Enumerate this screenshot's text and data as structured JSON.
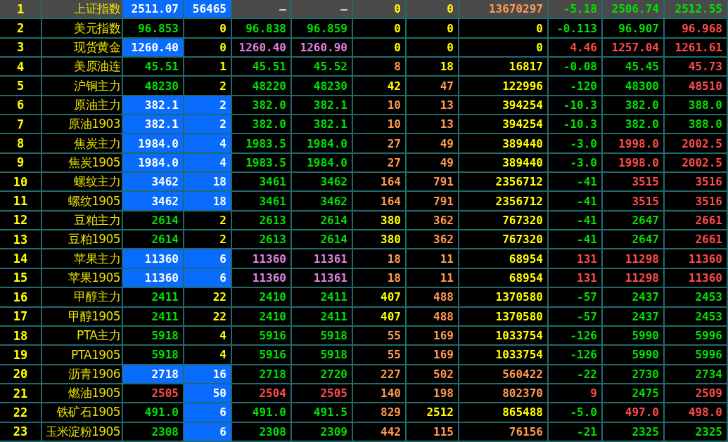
{
  "rows": [
    {
      "index": "1",
      "name": "上证指数",
      "selected": true,
      "cells": [
        {
          "text": "2511.07",
          "kind": "white",
          "highlighted": true
        },
        {
          "text": "56465",
          "kind": "white",
          "highlighted": true
        },
        {
          "text": "—",
          "kind": "none",
          "highlighted": false
        },
        {
          "text": "—",
          "kind": "none",
          "highlighted": false
        },
        {
          "text": "0",
          "kind": "neutral",
          "highlighted": false
        },
        {
          "text": "0",
          "kind": "neutral",
          "highlighted": false
        },
        {
          "text": "13670297",
          "kind": "active",
          "highlighted": false
        },
        {
          "text": "-5.18",
          "kind": "fall",
          "highlighted": false
        },
        {
          "text": "2506.74",
          "kind": "fall",
          "highlighted": false
        },
        {
          "text": "2512.55",
          "kind": "fall",
          "highlighted": false
        }
      ]
    },
    {
      "index": "2",
      "name": "美元指数",
      "selected": false,
      "cells": [
        {
          "text": "96.853",
          "kind": "fall",
          "highlighted": false
        },
        {
          "text": "0",
          "kind": "neutral",
          "highlighted": false
        },
        {
          "text": "96.838",
          "kind": "fall",
          "highlighted": false
        },
        {
          "text": "96.859",
          "kind": "fall",
          "highlighted": false
        },
        {
          "text": "0",
          "kind": "neutral",
          "highlighted": false
        },
        {
          "text": "0",
          "kind": "neutral",
          "highlighted": false
        },
        {
          "text": "0",
          "kind": "neutral",
          "highlighted": false
        },
        {
          "text": "-0.113",
          "kind": "fall",
          "highlighted": false
        },
        {
          "text": "96.907",
          "kind": "fall",
          "highlighted": false
        },
        {
          "text": "96.968",
          "kind": "rise",
          "highlighted": false
        }
      ]
    },
    {
      "index": "3",
      "name": "现货黄金",
      "selected": false,
      "cells": [
        {
          "text": "1260.40",
          "kind": "white",
          "highlighted": true
        },
        {
          "text": "0",
          "kind": "neutral",
          "highlighted": false
        },
        {
          "text": "1260.40",
          "kind": "quote",
          "highlighted": false
        },
        {
          "text": "1260.90",
          "kind": "quote",
          "highlighted": false
        },
        {
          "text": "0",
          "kind": "neutral",
          "highlighted": false
        },
        {
          "text": "0",
          "kind": "neutral",
          "highlighted": false
        },
        {
          "text": "0",
          "kind": "neutral",
          "highlighted": false
        },
        {
          "text": "4.46",
          "kind": "rise",
          "highlighted": false
        },
        {
          "text": "1257.04",
          "kind": "rise",
          "highlighted": false
        },
        {
          "text": "1261.61",
          "kind": "rise",
          "highlighted": false
        }
      ]
    },
    {
      "index": "4",
      "name": "美原油连",
      "selected": false,
      "cells": [
        {
          "text": "45.51",
          "kind": "fall",
          "highlighted": false
        },
        {
          "text": "1",
          "kind": "neutral",
          "highlighted": false
        },
        {
          "text": "45.51",
          "kind": "fall",
          "highlighted": false
        },
        {
          "text": "45.52",
          "kind": "fall",
          "highlighted": false
        },
        {
          "text": "8",
          "kind": "active",
          "highlighted": false
        },
        {
          "text": "18",
          "kind": "neutral",
          "highlighted": false
        },
        {
          "text": "16817",
          "kind": "neutral",
          "highlighted": false
        },
        {
          "text": "-0.08",
          "kind": "fall",
          "highlighted": false
        },
        {
          "text": "45.45",
          "kind": "fall",
          "highlighted": false
        },
        {
          "text": "45.73",
          "kind": "rise",
          "highlighted": false
        }
      ]
    },
    {
      "index": "5",
      "name": "沪铜主力",
      "selected": false,
      "cells": [
        {
          "text": "48230",
          "kind": "fall",
          "highlighted": false
        },
        {
          "text": "2",
          "kind": "neutral",
          "highlighted": false
        },
        {
          "text": "48220",
          "kind": "fall",
          "highlighted": false
        },
        {
          "text": "48230",
          "kind": "fall",
          "highlighted": false
        },
        {
          "text": "42",
          "kind": "neutral",
          "highlighted": false
        },
        {
          "text": "47",
          "kind": "active",
          "highlighted": false
        },
        {
          "text": "122996",
          "kind": "neutral",
          "highlighted": false
        },
        {
          "text": "-120",
          "kind": "fall",
          "highlighted": false
        },
        {
          "text": "48300",
          "kind": "fall",
          "highlighted": false
        },
        {
          "text": "48510",
          "kind": "rise",
          "highlighted": false
        }
      ]
    },
    {
      "index": "6",
      "name": "原油主力",
      "selected": false,
      "cells": [
        {
          "text": "382.1",
          "kind": "white",
          "highlighted": true
        },
        {
          "text": "2",
          "kind": "white",
          "highlighted": true
        },
        {
          "text": "382.0",
          "kind": "fall",
          "highlighted": false
        },
        {
          "text": "382.1",
          "kind": "fall",
          "highlighted": false
        },
        {
          "text": "10",
          "kind": "active",
          "highlighted": false
        },
        {
          "text": "13",
          "kind": "active",
          "highlighted": false
        },
        {
          "text": "394254",
          "kind": "neutral",
          "highlighted": false
        },
        {
          "text": "-10.3",
          "kind": "fall",
          "highlighted": false
        },
        {
          "text": "382.0",
          "kind": "fall",
          "highlighted": false
        },
        {
          "text": "388.0",
          "kind": "fall",
          "highlighted": false
        }
      ]
    },
    {
      "index": "7",
      "name": "原油1903",
      "selected": false,
      "cells": [
        {
          "text": "382.1",
          "kind": "white",
          "highlighted": true
        },
        {
          "text": "2",
          "kind": "white",
          "highlighted": true
        },
        {
          "text": "382.0",
          "kind": "fall",
          "highlighted": false
        },
        {
          "text": "382.1",
          "kind": "fall",
          "highlighted": false
        },
        {
          "text": "10",
          "kind": "active",
          "highlighted": false
        },
        {
          "text": "13",
          "kind": "active",
          "highlighted": false
        },
        {
          "text": "394254",
          "kind": "neutral",
          "highlighted": false
        },
        {
          "text": "-10.3",
          "kind": "fall",
          "highlighted": false
        },
        {
          "text": "382.0",
          "kind": "fall",
          "highlighted": false
        },
        {
          "text": "388.0",
          "kind": "fall",
          "highlighted": false
        }
      ]
    },
    {
      "index": "8",
      "name": "焦炭主力",
      "selected": false,
      "cells": [
        {
          "text": "1984.0",
          "kind": "white",
          "highlighted": true
        },
        {
          "text": "4",
          "kind": "white",
          "highlighted": true
        },
        {
          "text": "1983.5",
          "kind": "fall",
          "highlighted": false
        },
        {
          "text": "1984.0",
          "kind": "fall",
          "highlighted": false
        },
        {
          "text": "27",
          "kind": "active",
          "highlighted": false
        },
        {
          "text": "49",
          "kind": "active",
          "highlighted": false
        },
        {
          "text": "389440",
          "kind": "neutral",
          "highlighted": false
        },
        {
          "text": "-3.0",
          "kind": "fall",
          "highlighted": false
        },
        {
          "text": "1998.0",
          "kind": "rise",
          "highlighted": false
        },
        {
          "text": "2002.5",
          "kind": "rise",
          "highlighted": false
        }
      ]
    },
    {
      "index": "9",
      "name": "焦炭1905",
      "selected": false,
      "cells": [
        {
          "text": "1984.0",
          "kind": "white",
          "highlighted": true
        },
        {
          "text": "4",
          "kind": "white",
          "highlighted": true
        },
        {
          "text": "1983.5",
          "kind": "fall",
          "highlighted": false
        },
        {
          "text": "1984.0",
          "kind": "fall",
          "highlighted": false
        },
        {
          "text": "27",
          "kind": "active",
          "highlighted": false
        },
        {
          "text": "49",
          "kind": "active",
          "highlighted": false
        },
        {
          "text": "389440",
          "kind": "neutral",
          "highlighted": false
        },
        {
          "text": "-3.0",
          "kind": "fall",
          "highlighted": false
        },
        {
          "text": "1998.0",
          "kind": "rise",
          "highlighted": false
        },
        {
          "text": "2002.5",
          "kind": "rise",
          "highlighted": false
        }
      ]
    },
    {
      "index": "10",
      "name": "螺纹主力",
      "selected": false,
      "cells": [
        {
          "text": "3462",
          "kind": "white",
          "highlighted": true
        },
        {
          "text": "18",
          "kind": "white",
          "highlighted": true
        },
        {
          "text": "3461",
          "kind": "fall",
          "highlighted": false
        },
        {
          "text": "3462",
          "kind": "fall",
          "highlighted": false
        },
        {
          "text": "164",
          "kind": "active",
          "highlighted": false
        },
        {
          "text": "791",
          "kind": "active",
          "highlighted": false
        },
        {
          "text": "2356712",
          "kind": "neutral",
          "highlighted": false
        },
        {
          "text": "-41",
          "kind": "fall",
          "highlighted": false
        },
        {
          "text": "3515",
          "kind": "rise",
          "highlighted": false
        },
        {
          "text": "3516",
          "kind": "rise",
          "highlighted": false
        }
      ]
    },
    {
      "index": "11",
      "name": "螺纹1905",
      "selected": false,
      "cells": [
        {
          "text": "3462",
          "kind": "white",
          "highlighted": true
        },
        {
          "text": "18",
          "kind": "white",
          "highlighted": true
        },
        {
          "text": "3461",
          "kind": "fall",
          "highlighted": false
        },
        {
          "text": "3462",
          "kind": "fall",
          "highlighted": false
        },
        {
          "text": "164",
          "kind": "active",
          "highlighted": false
        },
        {
          "text": "791",
          "kind": "active",
          "highlighted": false
        },
        {
          "text": "2356712",
          "kind": "neutral",
          "highlighted": false
        },
        {
          "text": "-41",
          "kind": "fall",
          "highlighted": false
        },
        {
          "text": "3515",
          "kind": "rise",
          "highlighted": false
        },
        {
          "text": "3516",
          "kind": "rise",
          "highlighted": false
        }
      ]
    },
    {
      "index": "12",
      "name": "豆粕主力",
      "selected": false,
      "cells": [
        {
          "text": "2614",
          "kind": "fall",
          "highlighted": false
        },
        {
          "text": "2",
          "kind": "neutral",
          "highlighted": false
        },
        {
          "text": "2613",
          "kind": "fall",
          "highlighted": false
        },
        {
          "text": "2614",
          "kind": "fall",
          "highlighted": false
        },
        {
          "text": "380",
          "kind": "neutral",
          "highlighted": false
        },
        {
          "text": "362",
          "kind": "active",
          "highlighted": false
        },
        {
          "text": "767320",
          "kind": "neutral",
          "highlighted": false
        },
        {
          "text": "-41",
          "kind": "fall",
          "highlighted": false
        },
        {
          "text": "2647",
          "kind": "fall",
          "highlighted": false
        },
        {
          "text": "2661",
          "kind": "rise",
          "highlighted": false
        }
      ]
    },
    {
      "index": "13",
      "name": "豆粕1905",
      "selected": false,
      "cells": [
        {
          "text": "2614",
          "kind": "fall",
          "highlighted": false
        },
        {
          "text": "2",
          "kind": "neutral",
          "highlighted": false
        },
        {
          "text": "2613",
          "kind": "fall",
          "highlighted": false
        },
        {
          "text": "2614",
          "kind": "fall",
          "highlighted": false
        },
        {
          "text": "380",
          "kind": "neutral",
          "highlighted": false
        },
        {
          "text": "362",
          "kind": "active",
          "highlighted": false
        },
        {
          "text": "767320",
          "kind": "neutral",
          "highlighted": false
        },
        {
          "text": "-41",
          "kind": "fall",
          "highlighted": false
        },
        {
          "text": "2647",
          "kind": "fall",
          "highlighted": false
        },
        {
          "text": "2661",
          "kind": "rise",
          "highlighted": false
        }
      ]
    },
    {
      "index": "14",
      "name": "苹果主力",
      "selected": false,
      "cells": [
        {
          "text": "11360",
          "kind": "white",
          "highlighted": true
        },
        {
          "text": "6",
          "kind": "white",
          "highlighted": true
        },
        {
          "text": "11360",
          "kind": "quote",
          "highlighted": false
        },
        {
          "text": "11361",
          "kind": "quote",
          "highlighted": false
        },
        {
          "text": "18",
          "kind": "active",
          "highlighted": false
        },
        {
          "text": "11",
          "kind": "active",
          "highlighted": false
        },
        {
          "text": "68954",
          "kind": "neutral",
          "highlighted": false
        },
        {
          "text": "131",
          "kind": "rise",
          "highlighted": false
        },
        {
          "text": "11298",
          "kind": "rise",
          "highlighted": false
        },
        {
          "text": "11360",
          "kind": "rise",
          "highlighted": false
        }
      ]
    },
    {
      "index": "15",
      "name": "苹果1905",
      "selected": false,
      "cells": [
        {
          "text": "11360",
          "kind": "white",
          "highlighted": true
        },
        {
          "text": "6",
          "kind": "white",
          "highlighted": true
        },
        {
          "text": "11360",
          "kind": "quote",
          "highlighted": false
        },
        {
          "text": "11361",
          "kind": "quote",
          "highlighted": false
        },
        {
          "text": "18",
          "kind": "active",
          "highlighted": false
        },
        {
          "text": "11",
          "kind": "active",
          "highlighted": false
        },
        {
          "text": "68954",
          "kind": "neutral",
          "highlighted": false
        },
        {
          "text": "131",
          "kind": "rise",
          "highlighted": false
        },
        {
          "text": "11298",
          "kind": "rise",
          "highlighted": false
        },
        {
          "text": "11360",
          "kind": "rise",
          "highlighted": false
        }
      ]
    },
    {
      "index": "16",
      "name": "甲醇主力",
      "selected": false,
      "cells": [
        {
          "text": "2411",
          "kind": "fall",
          "highlighted": false
        },
        {
          "text": "22",
          "kind": "neutral",
          "highlighted": false
        },
        {
          "text": "2410",
          "kind": "fall",
          "highlighted": false
        },
        {
          "text": "2411",
          "kind": "fall",
          "highlighted": false
        },
        {
          "text": "407",
          "kind": "neutral",
          "highlighted": false
        },
        {
          "text": "488",
          "kind": "active",
          "highlighted": false
        },
        {
          "text": "1370580",
          "kind": "neutral",
          "highlighted": false
        },
        {
          "text": "-57",
          "kind": "fall",
          "highlighted": false
        },
        {
          "text": "2437",
          "kind": "fall",
          "highlighted": false
        },
        {
          "text": "2453",
          "kind": "fall",
          "highlighted": false
        }
      ]
    },
    {
      "index": "17",
      "name": "甲醇1905",
      "selected": false,
      "cells": [
        {
          "text": "2411",
          "kind": "fall",
          "highlighted": false
        },
        {
          "text": "22",
          "kind": "neutral",
          "highlighted": false
        },
        {
          "text": "2410",
          "kind": "fall",
          "highlighted": false
        },
        {
          "text": "2411",
          "kind": "fall",
          "highlighted": false
        },
        {
          "text": "407",
          "kind": "neutral",
          "highlighted": false
        },
        {
          "text": "488",
          "kind": "active",
          "highlighted": false
        },
        {
          "text": "1370580",
          "kind": "neutral",
          "highlighted": false
        },
        {
          "text": "-57",
          "kind": "fall",
          "highlighted": false
        },
        {
          "text": "2437",
          "kind": "fall",
          "highlighted": false
        },
        {
          "text": "2453",
          "kind": "fall",
          "highlighted": false
        }
      ]
    },
    {
      "index": "18",
      "name": "PTA主力",
      "selected": false,
      "cells": [
        {
          "text": "5918",
          "kind": "fall",
          "highlighted": false
        },
        {
          "text": "4",
          "kind": "neutral",
          "highlighted": false
        },
        {
          "text": "5916",
          "kind": "fall",
          "highlighted": false
        },
        {
          "text": "5918",
          "kind": "fall",
          "highlighted": false
        },
        {
          "text": "55",
          "kind": "active",
          "highlighted": false
        },
        {
          "text": "169",
          "kind": "active",
          "highlighted": false
        },
        {
          "text": "1033754",
          "kind": "neutral",
          "highlighted": false
        },
        {
          "text": "-126",
          "kind": "fall",
          "highlighted": false
        },
        {
          "text": "5990",
          "kind": "fall",
          "highlighted": false
        },
        {
          "text": "5996",
          "kind": "fall",
          "highlighted": false
        }
      ]
    },
    {
      "index": "19",
      "name": "PTA1905",
      "selected": false,
      "cells": [
        {
          "text": "5918",
          "kind": "fall",
          "highlighted": false
        },
        {
          "text": "4",
          "kind": "neutral",
          "highlighted": false
        },
        {
          "text": "5916",
          "kind": "fall",
          "highlighted": false
        },
        {
          "text": "5918",
          "kind": "fall",
          "highlighted": false
        },
        {
          "text": "55",
          "kind": "active",
          "highlighted": false
        },
        {
          "text": "169",
          "kind": "active",
          "highlighted": false
        },
        {
          "text": "1033754",
          "kind": "neutral",
          "highlighted": false
        },
        {
          "text": "-126",
          "kind": "fall",
          "highlighted": false
        },
        {
          "text": "5990",
          "kind": "fall",
          "highlighted": false
        },
        {
          "text": "5996",
          "kind": "fall",
          "highlighted": false
        }
      ]
    },
    {
      "index": "20",
      "name": "沥青1906",
      "selected": false,
      "cells": [
        {
          "text": "2718",
          "kind": "white",
          "highlighted": true
        },
        {
          "text": "16",
          "kind": "white",
          "highlighted": true
        },
        {
          "text": "2718",
          "kind": "fall",
          "highlighted": false
        },
        {
          "text": "2720",
          "kind": "fall",
          "highlighted": false
        },
        {
          "text": "227",
          "kind": "active",
          "highlighted": false
        },
        {
          "text": "502",
          "kind": "active",
          "highlighted": false
        },
        {
          "text": "560422",
          "kind": "active",
          "highlighted": false
        },
        {
          "text": "-22",
          "kind": "fall",
          "highlighted": false
        },
        {
          "text": "2730",
          "kind": "fall",
          "highlighted": false
        },
        {
          "text": "2734",
          "kind": "fall",
          "highlighted": false
        }
      ]
    },
    {
      "index": "21",
      "name": "燃油1905",
      "selected": false,
      "cells": [
        {
          "text": "2505",
          "kind": "rise",
          "highlighted": false
        },
        {
          "text": "50",
          "kind": "white",
          "highlighted": true
        },
        {
          "text": "2504",
          "kind": "rise",
          "highlighted": false
        },
        {
          "text": "2505",
          "kind": "rise",
          "highlighted": false
        },
        {
          "text": "140",
          "kind": "active",
          "highlighted": false
        },
        {
          "text": "198",
          "kind": "active",
          "highlighted": false
        },
        {
          "text": "802370",
          "kind": "active",
          "highlighted": false
        },
        {
          "text": "9",
          "kind": "rise",
          "highlighted": false
        },
        {
          "text": "2475",
          "kind": "fall",
          "highlighted": false
        },
        {
          "text": "2509",
          "kind": "rise",
          "highlighted": false
        }
      ]
    },
    {
      "index": "22",
      "name": "铁矿石1905",
      "selected": false,
      "cells": [
        {
          "text": "491.0",
          "kind": "fall",
          "highlighted": false
        },
        {
          "text": "6",
          "kind": "white",
          "highlighted": true
        },
        {
          "text": "491.0",
          "kind": "fall",
          "highlighted": false
        },
        {
          "text": "491.5",
          "kind": "fall",
          "highlighted": false
        },
        {
          "text": "829",
          "kind": "active",
          "highlighted": false
        },
        {
          "text": "2512",
          "kind": "neutral",
          "highlighted": false
        },
        {
          "text": "865488",
          "kind": "neutral",
          "highlighted": false
        },
        {
          "text": "-5.0",
          "kind": "fall",
          "highlighted": false
        },
        {
          "text": "497.0",
          "kind": "rise",
          "highlighted": false
        },
        {
          "text": "498.0",
          "kind": "rise",
          "highlighted": false
        }
      ]
    },
    {
      "index": "23",
      "name": "玉米淀粉1905",
      "selected": false,
      "cells": [
        {
          "text": "2308",
          "kind": "fall",
          "highlighted": false
        },
        {
          "text": "6",
          "kind": "white",
          "highlighted": true
        },
        {
          "text": "2308",
          "kind": "fall",
          "highlighted": false
        },
        {
          "text": "2309",
          "kind": "fall",
          "highlighted": false
        },
        {
          "text": "442",
          "kind": "active",
          "highlighted": false
        },
        {
          "text": "115",
          "kind": "active",
          "highlighted": false
        },
        {
          "text": "76156",
          "kind": "active",
          "highlighted": false
        },
        {
          "text": "-21",
          "kind": "fall",
          "highlighted": false
        },
        {
          "text": "2325",
          "kind": "fall",
          "highlighted": false
        },
        {
          "text": "2325",
          "kind": "fall",
          "highlighted": false
        }
      ]
    }
  ]
}
